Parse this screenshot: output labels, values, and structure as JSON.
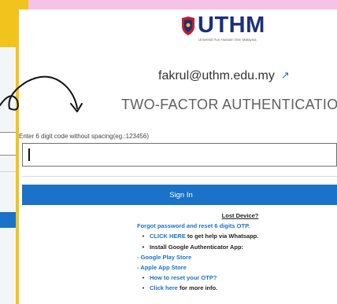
{
  "brand": {
    "logo_text": "UTHM",
    "logo_subtitle": "Universiti Tun Hussein Onn Malaysia"
  },
  "account": {
    "email": "fakrul@uthm.edu.my"
  },
  "page": {
    "heading": "TWO-FACTOR AUTHENTICATION"
  },
  "otp": {
    "label": "Enter 6 digit code without spacing(eg.:123456)",
    "value": ""
  },
  "signin": {
    "label": "Sign In"
  },
  "help": {
    "title": "Lost Device?",
    "forgot": "Forgot password and reset 6 digits OTP.",
    "whatsapp_link": "CLICK HERE",
    "whatsapp_rest": " to get help via Whatsapp.",
    "install": "Install Google Authenticator App:",
    "play_store": "- Google Play Store",
    "apple_store": "- Apple App Store",
    "reset_otp": "How to reset your OTP?",
    "more_link": "Click here",
    "more_rest": " for more info."
  },
  "colors": {
    "accent": "#1a72c9",
    "brand_navy": "#1b2f7a",
    "frame_yellow": "#f3c31d",
    "frame_pink": "#f6c2e6"
  }
}
